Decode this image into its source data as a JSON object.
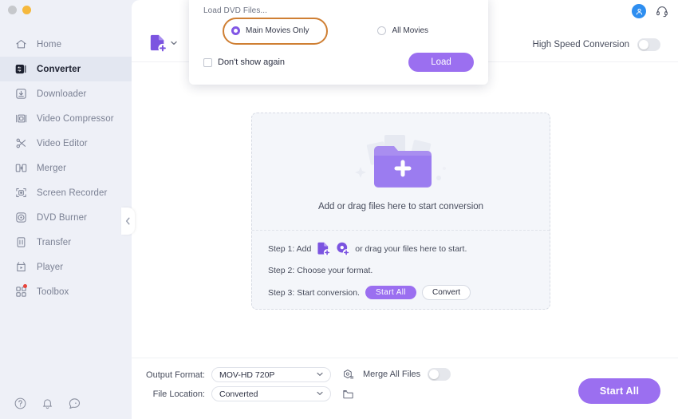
{
  "window": {
    "buttons": [
      {
        "name": "close-button",
        "color": "#c6c8cc"
      },
      {
        "name": "minimize-button",
        "color": "#f5b83d"
      }
    ]
  },
  "sidebar": {
    "items": [
      {
        "label": "Home",
        "icon": "home-icon",
        "active": false,
        "badge": false
      },
      {
        "label": "Converter",
        "icon": "converter-icon",
        "active": true,
        "badge": false
      },
      {
        "label": "Downloader",
        "icon": "download-icon",
        "active": false,
        "badge": false
      },
      {
        "label": "Video Compressor",
        "icon": "compressor-icon",
        "active": false,
        "badge": false
      },
      {
        "label": "Video Editor",
        "icon": "scissors-icon",
        "active": false,
        "badge": false
      },
      {
        "label": "Merger",
        "icon": "merger-icon",
        "active": false,
        "badge": false
      },
      {
        "label": "Screen Recorder",
        "icon": "screen-recorder-icon",
        "active": false,
        "badge": false
      },
      {
        "label": "DVD Burner",
        "icon": "disc-icon",
        "active": false,
        "badge": false
      },
      {
        "label": "Transfer",
        "icon": "transfer-icon",
        "active": false,
        "badge": false
      },
      {
        "label": "Player",
        "icon": "player-icon",
        "active": false,
        "badge": false
      },
      {
        "label": "Toolbox",
        "icon": "toolbox-icon",
        "active": false,
        "badge": true
      }
    ],
    "bottom_icons": [
      "help-icon",
      "bell-icon",
      "feedback-icon"
    ],
    "collapse_icon": "chevron-left-icon"
  },
  "topright": {
    "avatar_icon": "user-avatar-icon",
    "support_icon": "headset-icon"
  },
  "toolbar": {
    "add_file_icon": "add-file-icon",
    "add_file_caret": "chevron-down-icon",
    "high_speed_label": "High Speed Conversion",
    "high_speed_enabled": false
  },
  "dropzone": {
    "hint": "Add or drag files here to start conversion",
    "folder_icon": "add-folder-icon",
    "steps": [
      {
        "prefix": "Step 1: Add",
        "suffix": "or drag your files here to start.",
        "icons": [
          "add-file-icon",
          "add-disc-icon"
        ]
      },
      {
        "prefix": "Step 2: Choose your format.",
        "suffix": "",
        "icons": []
      },
      {
        "prefix": "Step 3: Start conversion.",
        "suffix": "",
        "icons": [],
        "buttons": [
          {
            "label": "Start  All",
            "style": "primary"
          },
          {
            "label": "Convert",
            "style": "outline"
          }
        ]
      }
    ]
  },
  "bottombar": {
    "output_format_label": "Output Format:",
    "output_format_value": "MOV-HD 720P",
    "file_location_label": "File Location:",
    "file_location_value": "Converted",
    "settings_icon": "format-settings-icon",
    "folder_icon": "open-folder-icon",
    "merge_label": "Merge All Files",
    "merge_enabled": false,
    "start_all_label": "Start All"
  },
  "dialog": {
    "title": "Load DVD Files...",
    "options": [
      {
        "label": "Main Movies Only",
        "selected": true,
        "highlighted": true
      },
      {
        "label": "All Movies",
        "selected": false,
        "highlighted": false
      }
    ],
    "dont_show_label": "Don't show again",
    "dont_show_checked": false,
    "load_label": "Load"
  },
  "colors": {
    "accent": "#9b6ff0",
    "radio_accent": "#8257e5",
    "highlight_ring": "#cf7f33",
    "sidebar_bg": "#eef0f7",
    "avatar_blue": "#2e8ef0",
    "badge_red": "#e8453c"
  }
}
